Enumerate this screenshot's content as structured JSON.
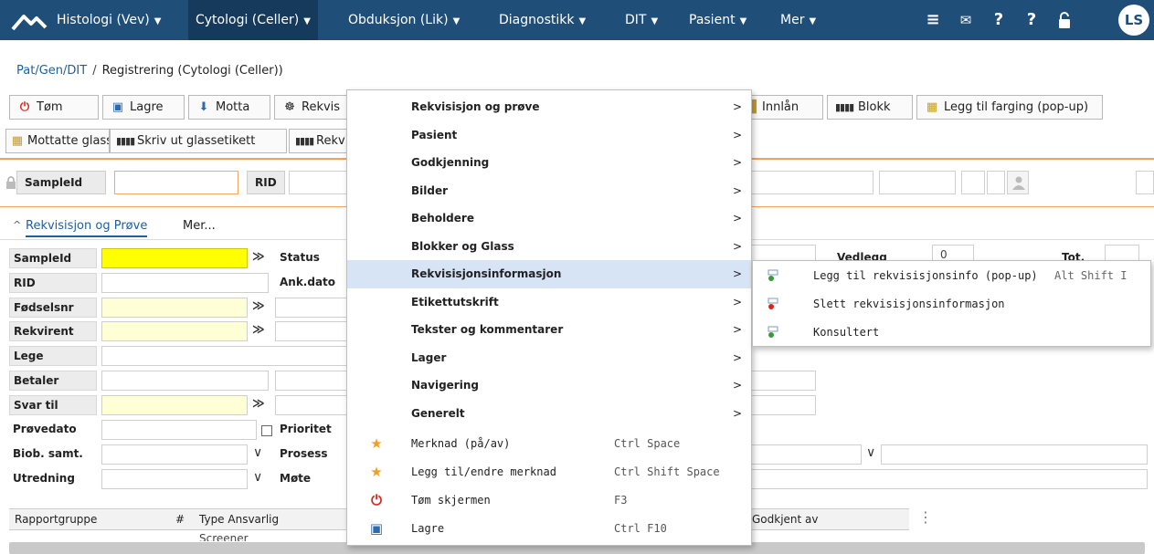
{
  "nav": {
    "menus": [
      {
        "label": "Histologi (Vev)"
      },
      {
        "label": "Cytologi (Celler)"
      },
      {
        "label": "Obduksjon (Lik)"
      },
      {
        "label": "Diagnostikk"
      },
      {
        "label": "DIT"
      },
      {
        "label": "Pasient"
      },
      {
        "label": "Mer"
      }
    ],
    "caret": "▼",
    "icons": [
      "hamburger-icon",
      "mail-icon",
      "help-icon",
      "help-icon",
      "lock-open-icon"
    ],
    "avatar": "LS"
  },
  "breadcrumb": {
    "link": "Pat/Gen/DIT",
    "separator": "/",
    "current": "Registrering (Cytologi (Celler))"
  },
  "toolbar": {
    "row1": {
      "tom": "Tøm",
      "lagre": "Lagre",
      "motta": "Motta",
      "rekvis": "Rekvis",
      "innlan": "Innlån",
      "blokk": "Blokk",
      "farging": "Legg til farging (pop-up)"
    },
    "row2": {
      "mottatte": "Mottatte glass",
      "glassetikett": "Skriv ut glassetikett",
      "rekv": "Rekv"
    }
  },
  "quick": {
    "sampleid": "SampleId",
    "rid": "RID"
  },
  "tabs": {
    "active": "Rekvisisjon og Prøve",
    "more": "Mer...",
    "chevron": "^"
  },
  "form": {
    "left": [
      "SampleId",
      "RID",
      "Fødselsnr",
      "Rekvirent",
      "Lege",
      "Betaler",
      "Svar til",
      "Prøvedato",
      "Biob. samt.",
      "Utredning"
    ],
    "mid": {
      "status": "Status",
      "ankdato": "Ank.dato",
      "prioritet": "Prioritet",
      "prosess": "Prosess",
      "mote": "Møte"
    },
    "right": {
      "vedlegg": "Vedlegg",
      "vedlegg_value": "0",
      "tot": "Tot."
    },
    "dbl": "≫",
    "chev": "∨"
  },
  "table": {
    "headers": [
      "Rapportgruppe",
      "#",
      "Type Ansvarlig",
      "Godkjent av"
    ],
    "partial_row": "Screener"
  },
  "context_menu": {
    "items": [
      {
        "label": "Rekvisisjon og prøve",
        "arrow": ">"
      },
      {
        "label": "Pasient",
        "arrow": ">"
      },
      {
        "label": "Godkjenning",
        "arrow": ">"
      },
      {
        "label": "Bilder",
        "arrow": ">"
      },
      {
        "label": "Beholdere",
        "arrow": ">"
      },
      {
        "label": "Blokker og Glass",
        "arrow": ">"
      },
      {
        "label": "Rekvisisjonsinformasjon",
        "arrow": ">"
      },
      {
        "label": "Etikettutskrift",
        "arrow": ">"
      },
      {
        "label": "Tekster og kommentarer",
        "arrow": ">"
      },
      {
        "label": "Lager",
        "arrow": ">"
      },
      {
        "label": "Navigering",
        "arrow": ">"
      },
      {
        "label": "Generelt",
        "arrow": ">"
      }
    ],
    "actions": [
      {
        "label": "Merknad (på/av)",
        "shortcut": "Ctrl Space",
        "icon": "star-icon"
      },
      {
        "label": "Legg til/endre merknad",
        "shortcut": "Ctrl Shift Space",
        "icon": "star-icon"
      },
      {
        "label": "Tøm skjermen",
        "shortcut": "F3",
        "icon": "power-icon"
      },
      {
        "label": "Lagre",
        "shortcut": "Ctrl F10",
        "icon": "save-icon"
      }
    ]
  },
  "submenu": {
    "items": [
      {
        "label": "Legg til rekvisisjonsinfo (pop-up)",
        "shortcut": "Alt Shift I"
      },
      {
        "label": "Slett rekvisisjonsinformasjon",
        "shortcut": ""
      },
      {
        "label": "Konsultert",
        "shortcut": ""
      }
    ]
  },
  "colors": {
    "nav_bg": "#1f4e79",
    "highlight": "#d6e4f5",
    "yellow": "#ffff00",
    "orange_line": "#f0a060"
  }
}
